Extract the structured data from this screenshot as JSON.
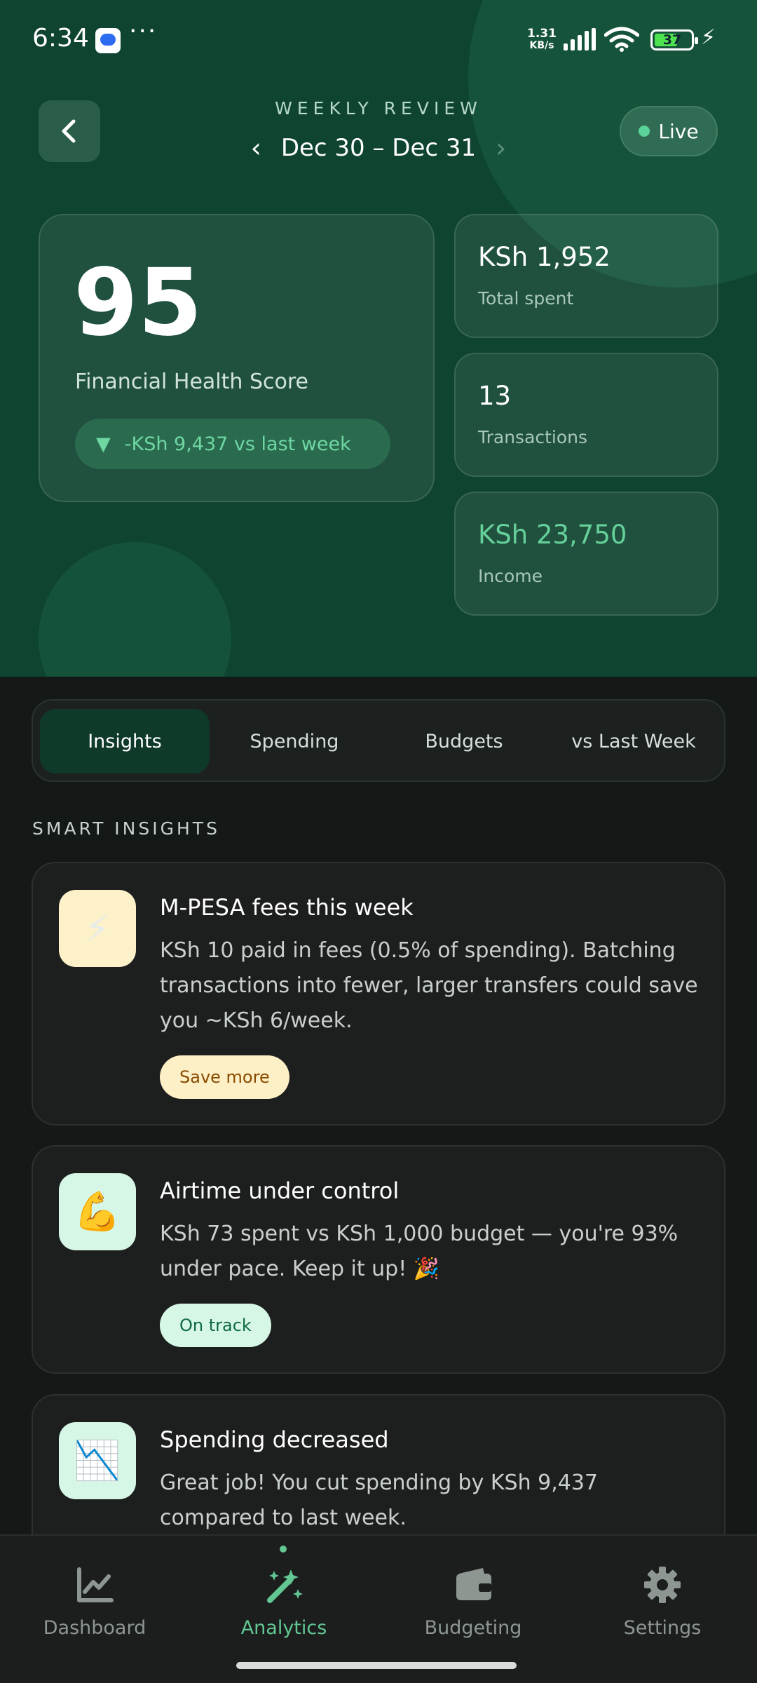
{
  "status_bar": {
    "time": "6:34",
    "net_speed_value": "1.31",
    "net_speed_unit": "KB/s",
    "battery": "37",
    "dots": "···"
  },
  "header": {
    "kicker": "WEEKLY REVIEW",
    "date_range": "Dec 30 – Dec 31",
    "live_label": "Live"
  },
  "score": {
    "value": "95",
    "label": "Financial Health Score",
    "delta_arrow": "▼",
    "delta_text": "-KSh 9,437 vs last week"
  },
  "stats": [
    {
      "value": "KSh 1,952",
      "label": "Total spent"
    },
    {
      "value": "13",
      "label": "Transactions"
    },
    {
      "value": "KSh 23,750",
      "label": "Income"
    }
  ],
  "tabs": [
    {
      "label": "Insights",
      "active": true
    },
    {
      "label": "Spending",
      "active": false
    },
    {
      "label": "Budgets",
      "active": false
    },
    {
      "label": "vs Last Week",
      "active": false
    }
  ],
  "section_title": "SMART INSIGHTS",
  "insights": [
    {
      "icon": "lightning-icon",
      "glyph": "⚡",
      "title": "M-PESA fees this week",
      "body": "KSh 10 paid in fees (0.5% of spending). Batching transactions into fewer, larger transfers could save you ~KSh 6/week.",
      "badge": "Save more",
      "badge_bg": "#fdefc6",
      "badge_color": "#8a4b00",
      "icon_bg": "#fdf1c9"
    },
    {
      "icon": "flexed-biceps-icon",
      "glyph": "💪",
      "title": "Airtime under control",
      "body": "KSh 73 spent vs KSh 1,000 budget — you're 93% under pace. Keep it up! 🎉",
      "badge": "On track",
      "badge_bg": "#d7f7e6",
      "badge_color": "#0f6a43",
      "icon_bg": "#d7f7e6"
    },
    {
      "icon": "chart-decreasing-icon",
      "glyph": "📉",
      "title": "Spending decreased",
      "body": "Great job! You cut spending by KSh 9,437 compared to last week.",
      "icon_bg": "#d7f7e6"
    }
  ],
  "bottom_nav": [
    {
      "label": "Dashboard",
      "icon": "chart-line-icon",
      "active": false
    },
    {
      "label": "Analytics",
      "icon": "magic-wand-icon",
      "active": true
    },
    {
      "label": "Budgeting",
      "icon": "wallet-icon",
      "active": false
    },
    {
      "label": "Settings",
      "icon": "gear-icon",
      "active": false
    }
  ],
  "colors": {
    "hero_bg": "#0e4430",
    "accent_green": "#62c793",
    "page_bg": "#141816"
  }
}
